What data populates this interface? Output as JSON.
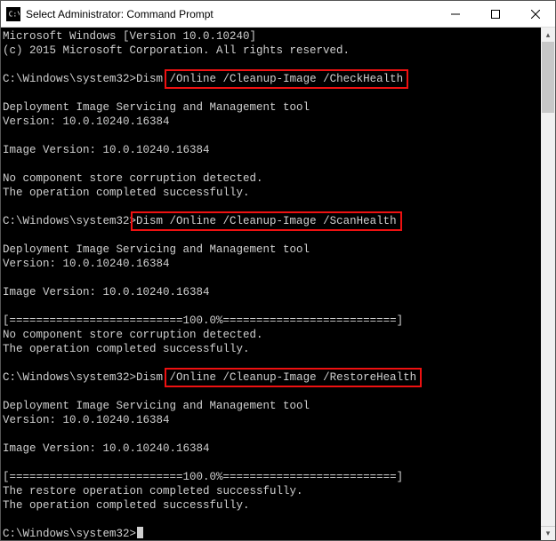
{
  "window": {
    "title": "Select Administrator: Command Prompt"
  },
  "console": {
    "prompt": "C:\\Windows\\system32>",
    "header1": "Microsoft Windows [Version 10.0.10240]",
    "header2": "(c) 2015 Microsoft Corporation. All rights reserved.",
    "cmd1_prefix": "Dism ",
    "cmd1_hl": "/Online /Cleanup-Image /CheckHealth",
    "tool_line": "Deployment Image Servicing and Management tool",
    "version_line": "Version: 10.0.10240.16384",
    "image_version": "Image Version: 10.0.10240.16384",
    "no_corrupt": "No component store corruption detected.",
    "op_success": "The operation completed successfully.",
    "cmd2_hl": "Dism /Online /Cleanup-Image /ScanHealth",
    "progress": "[==========================100.0%==========================]",
    "cmd3_prefix": "Dism ",
    "cmd3_hl": "/Online /Cleanup-Image /RestoreHealth",
    "restore_success": "The restore operation completed successfully."
  },
  "highlights": [
    "/Online /Cleanup-Image /CheckHealth",
    "Dism /Online /Cleanup-Image /ScanHealth",
    "/Online /Cleanup-Image /RestoreHealth"
  ]
}
